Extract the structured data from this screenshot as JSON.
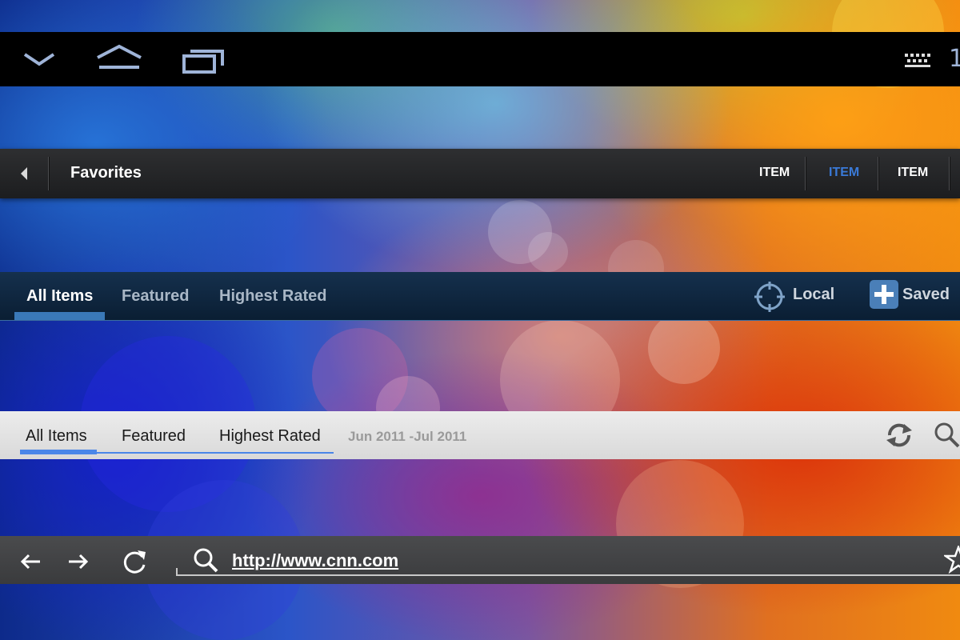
{
  "system_bar": {
    "icons": [
      "back-chevron-icon",
      "home-icon",
      "recent-apps-icon",
      "keyboard-icon"
    ],
    "clock_partial": "1"
  },
  "action_bar": {
    "title": "Favorites",
    "items": [
      "ITEM",
      "ITEM",
      "ITEM"
    ],
    "selected_index": 1,
    "selected_color": "#3a7ad8"
  },
  "dark_tabs": {
    "tabs": [
      "All Items",
      "Featured",
      "Highest Rated"
    ],
    "selected_index": 0,
    "actions": [
      "Local",
      "Saved"
    ]
  },
  "light_tabs": {
    "tabs": [
      "All Items",
      "Featured",
      "Highest Rated"
    ],
    "selected_index": 0,
    "date_range": "Jun 2011 -Jul 2011"
  },
  "browser_bar": {
    "url": "http://www.cnn.com"
  }
}
